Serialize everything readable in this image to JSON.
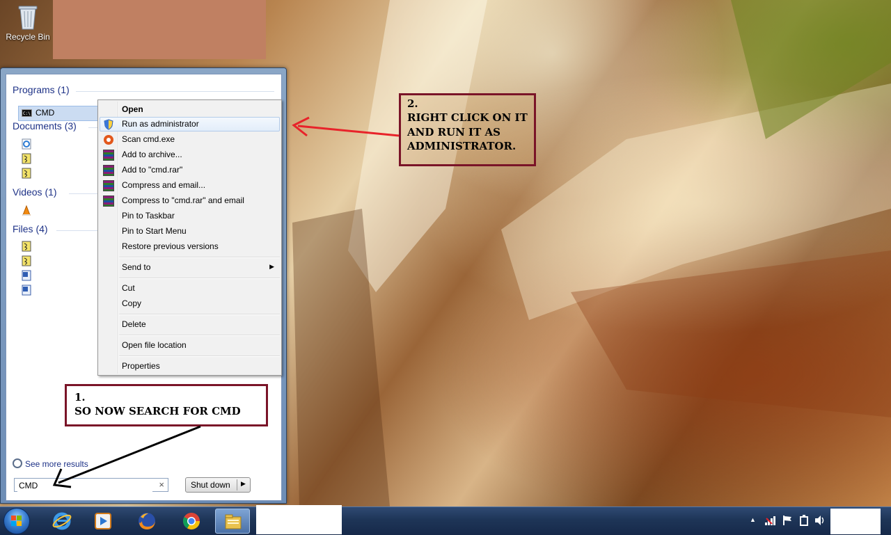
{
  "desktop": {
    "recycle_bin_label": "Recycle Bin"
  },
  "start_menu": {
    "categories": {
      "programs": "Programs (1)",
      "documents": "Documents (3)",
      "videos": "Videos (1)",
      "files": "Files (4)"
    },
    "program_item": "CMD",
    "see_more": "See more results",
    "search": {
      "value": "CMD",
      "clear": "×"
    },
    "shutdown_label": "Shut down",
    "shutdown_arrow": "▶"
  },
  "context_menu": {
    "items": [
      "Open",
      "Run as administrator",
      "Scan cmd.exe",
      "Add to archive...",
      "Add to \"cmd.rar\"",
      "Compress and email...",
      "Compress to \"cmd.rar\" and email",
      "Pin to Taskbar",
      "Pin to Start Menu",
      "Restore previous versions",
      "Send to",
      "Cut",
      "Copy",
      "Delete",
      "Open file location",
      "Properties"
    ],
    "submenu_arrow": "▶"
  },
  "annotations": {
    "note1": {
      "num": "1.",
      "text": "SO NOW SEARCH FOR CMD"
    },
    "note2": {
      "num": "2.",
      "line1": "RIGHT CLICK ON IT",
      "line2": "AND RUN IT AS",
      "line3": "ADMINISTRATOR."
    }
  },
  "taskbar": {
    "apps": [
      "internet-explorer-icon",
      "media-player-icon",
      "firefox-icon",
      "chrome-icon",
      "explorer-icon"
    ],
    "tray_arrow": "▲"
  },
  "colors": {
    "annotation_border": "#7a1428",
    "category_text": "#1e3287",
    "redaction": "#c08062"
  }
}
